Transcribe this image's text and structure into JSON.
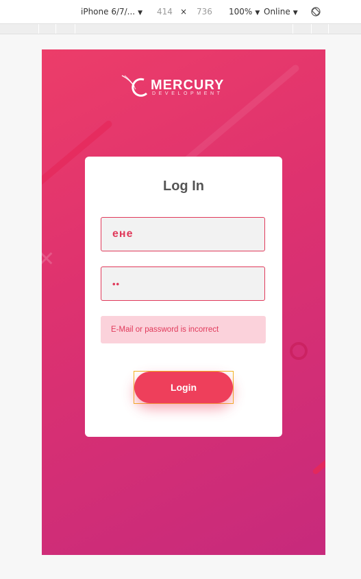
{
  "devtools": {
    "device": "iPhone 6/7/...",
    "width": "414",
    "times": "×",
    "height": "736",
    "zoom": "100%",
    "network": "Online",
    "rotate_icon": "rotate-icon"
  },
  "brand": {
    "name": "MERCURY",
    "subtitle": "DEVELOPMENT"
  },
  "login": {
    "title": "Log In",
    "email_value": "ене",
    "password_value": "••",
    "error": "E-Mail or password is incorrect",
    "button_label": "Login"
  },
  "colors": {
    "accent": "#ee3f5b",
    "error_bg": "#fbd2db",
    "gradient_start": "#ec3d69",
    "gradient_end": "#c72a7c"
  }
}
